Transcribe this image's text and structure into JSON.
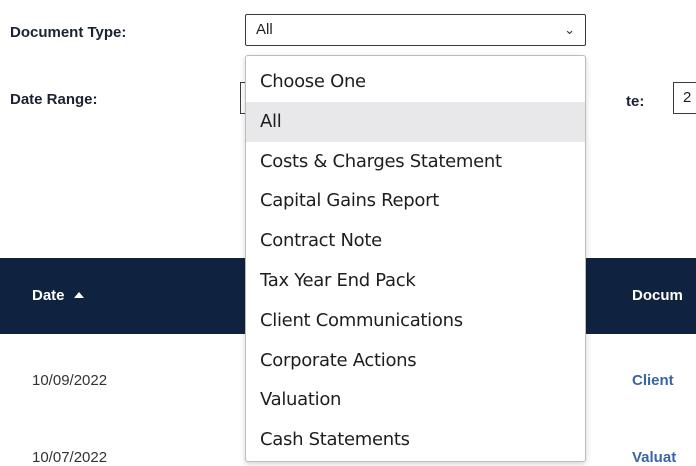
{
  "filters": {
    "doc_type_label": "Document Type:",
    "doc_type_value": "All",
    "date_range_label": "Date Range:",
    "to_date_label_partial": "te:",
    "to_date_value_partial": "2"
  },
  "dropdown": {
    "options": [
      "Choose One",
      "All",
      "Costs & Charges Statement",
      "Capital Gains Report",
      "Contract Note",
      "Tax Year End Pack",
      "Client Communications",
      "Corporate Actions",
      "Valuation",
      "Cash Statements"
    ],
    "selected": "All"
  },
  "table": {
    "headers": {
      "date": "Date",
      "document_partial": "Docum"
    },
    "rows": [
      {
        "date": "10/09/2022",
        "document_partial": "Client"
      },
      {
        "date": "10/07/2022",
        "document_partial": "Valuat"
      }
    ]
  },
  "colors": {
    "header_bg": "#0f2340",
    "link": "#3b64a4",
    "selected_bg": "#e8e8ea"
  },
  "icons": {
    "select_chevron": "chevron-down-icon",
    "sort": "sort-ascending-icon"
  }
}
